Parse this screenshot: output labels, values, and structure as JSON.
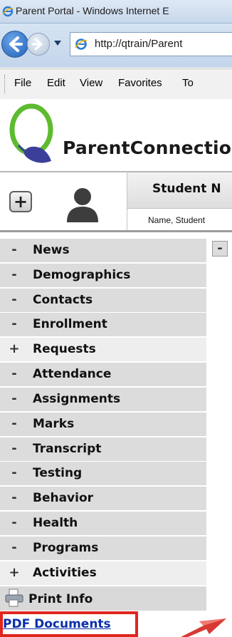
{
  "window": {
    "title": "Parent Portal - Windows Internet E",
    "url": "http://qtrain/Parent"
  },
  "menu": [
    "File",
    "Edit",
    "View",
    "Favorites",
    "To"
  ],
  "brand": "ParentConnectio",
  "student": {
    "header": "Student N",
    "name": "Name, Student",
    "add_label": "+"
  },
  "nav": {
    "items": [
      {
        "sign": "-",
        "label": "News"
      },
      {
        "sign": "-",
        "label": "Demographics"
      },
      {
        "sign": "-",
        "label": "Contacts"
      },
      {
        "sign": "-",
        "label": "Enrollment"
      },
      {
        "sign": "+",
        "label": "Requests"
      },
      {
        "sign": "-",
        "label": "Attendance"
      },
      {
        "sign": "-",
        "label": "Assignments"
      },
      {
        "sign": "-",
        "label": "Marks"
      },
      {
        "sign": "-",
        "label": "Transcript"
      },
      {
        "sign": "-",
        "label": "Testing"
      },
      {
        "sign": "-",
        "label": "Behavior"
      },
      {
        "sign": "-",
        "label": "Health"
      },
      {
        "sign": "-",
        "label": "Programs"
      },
      {
        "sign": "+",
        "label": "Activities"
      }
    ],
    "side_sign": "-",
    "print_info": "Print Info",
    "pdf_documents": "PDF Documents"
  },
  "colors": {
    "highlight_border": "#e0261f",
    "link": "#0b2fa8"
  }
}
